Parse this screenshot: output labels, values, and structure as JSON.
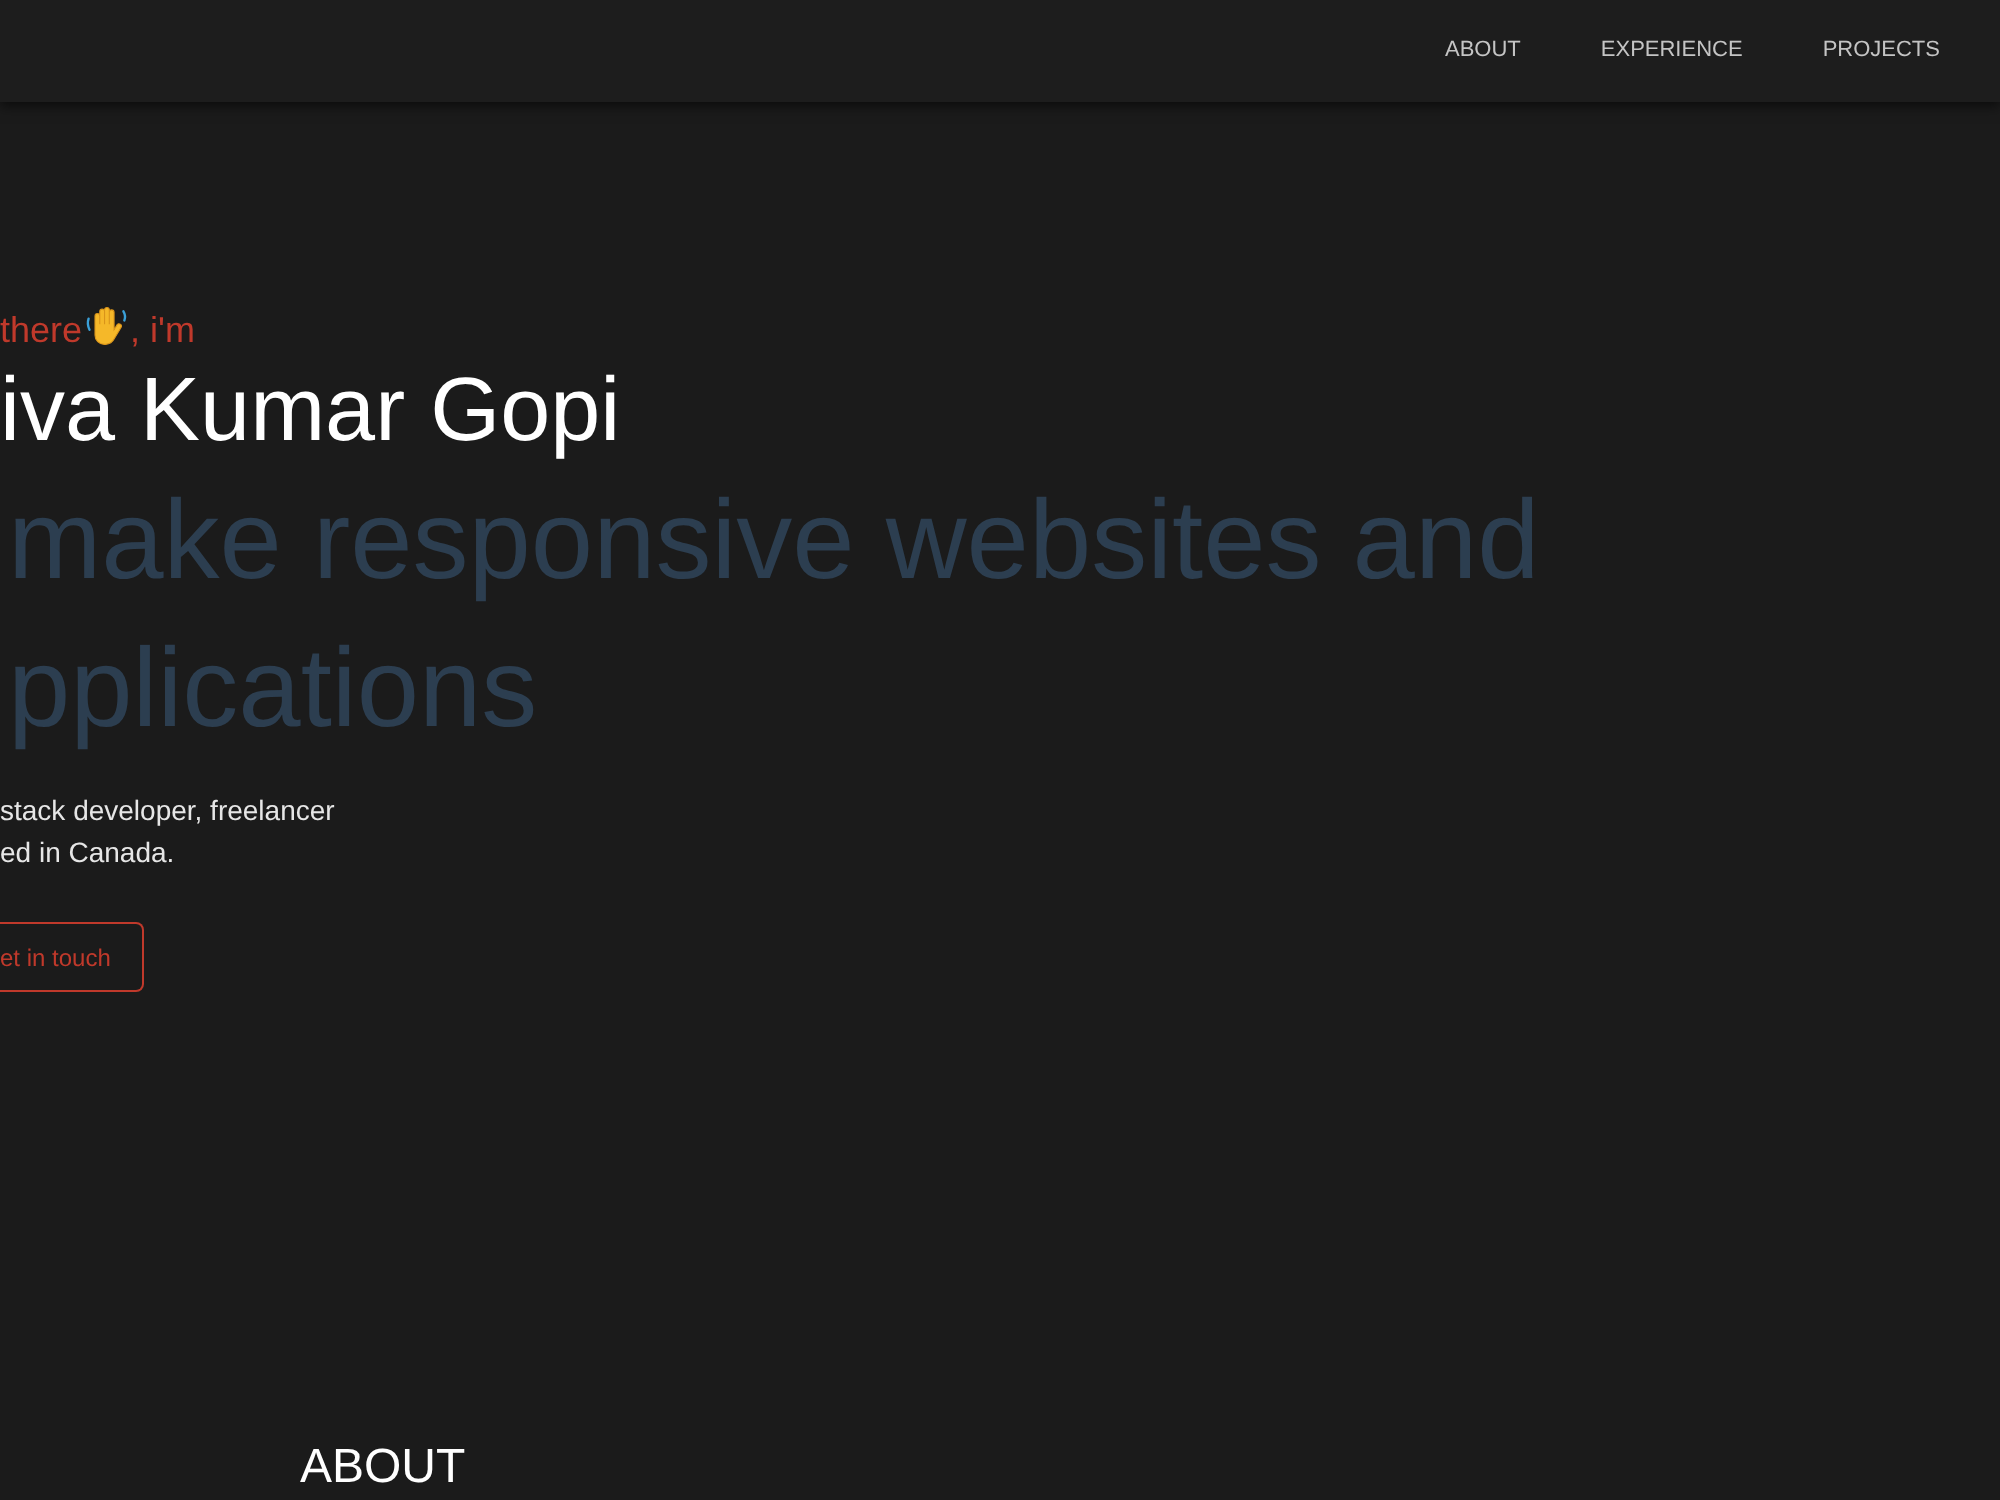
{
  "nav": {
    "links": [
      "ABOUT",
      "EXPERIENCE",
      "PROJECTS"
    ]
  },
  "hero": {
    "greeting": {
      "before": "there",
      "after": ", i'm"
    },
    "name": "iva Kumar Gopi",
    "tagline": [
      "make responsive websites and",
      "pplications"
    ],
    "bio": [
      "stack developer, freelancer",
      "ed in Canada."
    ],
    "button": "et in touch"
  },
  "next_section": {
    "heading": "ABOUT"
  }
}
